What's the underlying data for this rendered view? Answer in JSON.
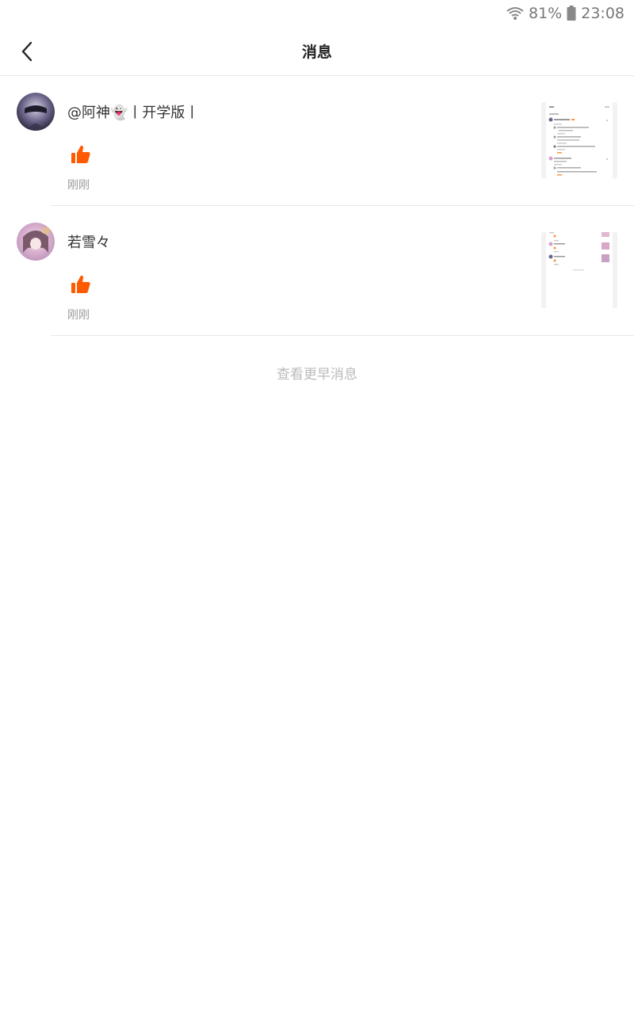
{
  "status_bar": {
    "battery": "81%",
    "time": "23:08"
  },
  "header": {
    "title": "消息",
    "back_icon": "chevron-left-icon"
  },
  "messages": [
    {
      "name": "@阿神👻丨开学版丨",
      "action_icon": "thumbs-up-icon",
      "time": "刚刚"
    },
    {
      "name": "若雪々",
      "action_icon": "thumbs-up-icon",
      "time": "刚刚"
    }
  ],
  "load_more": "查看更早消息",
  "colors": {
    "accent": "#ff5a00",
    "divider": "#e8e8e8",
    "muted": "#999999"
  }
}
